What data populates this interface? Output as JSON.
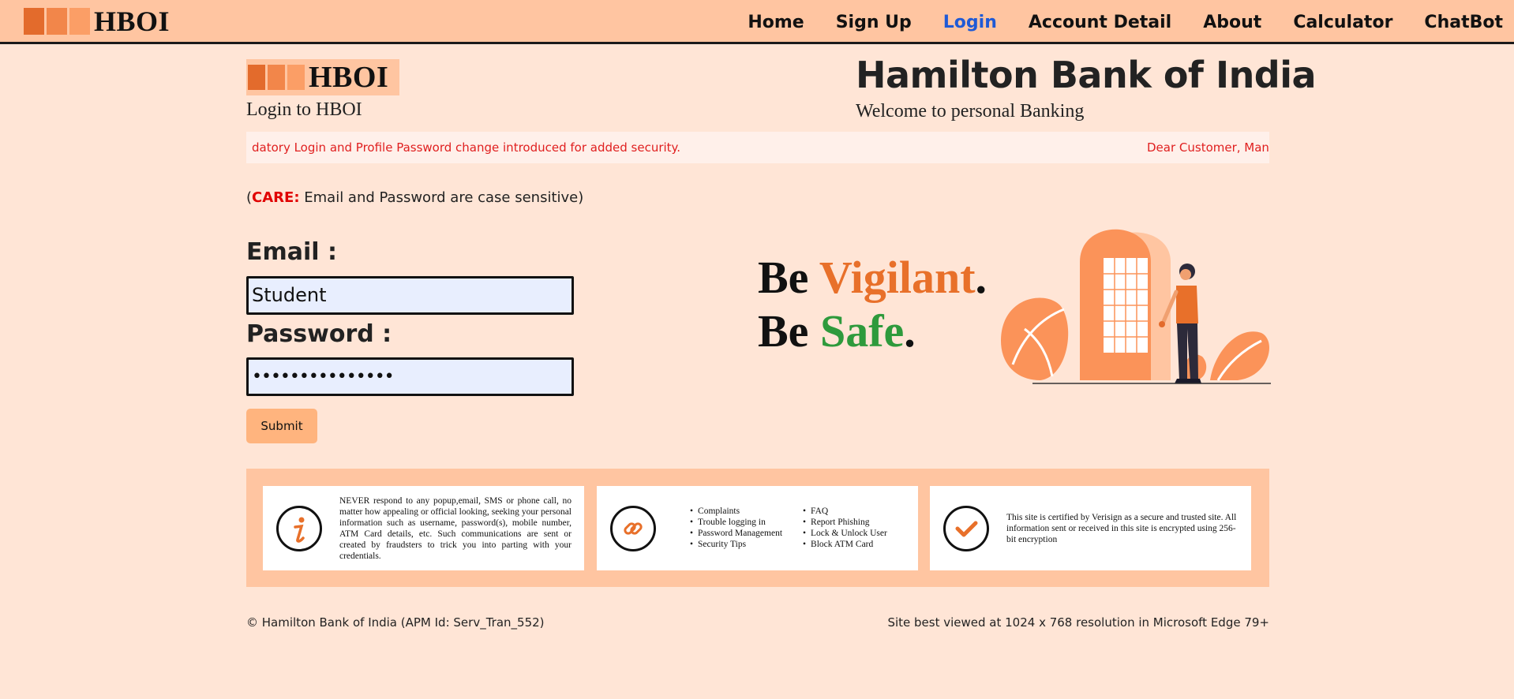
{
  "nav": {
    "logo_text": "HBOI",
    "links": [
      "Home",
      "Sign Up",
      "Login",
      "Account Detail",
      "About",
      "Calculator",
      "ChatBot"
    ],
    "active": "Login"
  },
  "header": {
    "logo_text": "HBOI",
    "login_subtitle": "Login to HBOI",
    "bank_name": "Hamilton Bank of India",
    "welcome": "Welcome to personal Banking"
  },
  "marquee": {
    "visible_left": "datory Login and Profile Password change introduced for added security.",
    "visible_right": "Dear Customer, Man"
  },
  "care": {
    "open": "(",
    "word": "CARE:",
    "rest": " Email and Password are case sensitive)"
  },
  "form": {
    "email_label": "Email :",
    "email_value": "Student",
    "password_label": "Password :",
    "password_mask": "•••••••••••••••",
    "submit_label": "Submit"
  },
  "banner": {
    "be1": "Be ",
    "vigilant": "Vigilant",
    "be2": "Be ",
    "safe": "Safe",
    "dot": "."
  },
  "info": {
    "card1_text": "NEVER respond to any popup,email, SMS or phone call, no matter how appealing or official looking, seeking your personal information such as username, password(s), mobile number, ATM Card details, etc. Such communications are sent or created by fraudsters to trick you into parting with your credentials.",
    "links_col1": [
      "Complaints",
      "Trouble logging in",
      "Password Management",
      "Security Tips"
    ],
    "links_col2": [
      "FAQ",
      "Report Phishing",
      "Lock & Unlock User",
      "Block ATM Card"
    ],
    "card3_text": "This site is certified by Verisign as a secure and trusted site. All information sent or received in this site is encrypted using 256-bit encryption"
  },
  "footer": {
    "left": "© Hamilton Bank of India (APM Id: Serv_Tran_552)",
    "right": "Site best viewed at 1024 x 768 resolution in Microsoft Edge 79+"
  },
  "colors": {
    "nav_bg": "#ffc5a1",
    "page_bg": "#ffe5d6",
    "active_link": "#1f5ad6",
    "accent_orange": "#e8702a",
    "safe_green": "#2e9a3c",
    "marquee_red": "#e02020"
  },
  "icons": [
    "info-icon",
    "link-icon",
    "checkmark-icon"
  ]
}
